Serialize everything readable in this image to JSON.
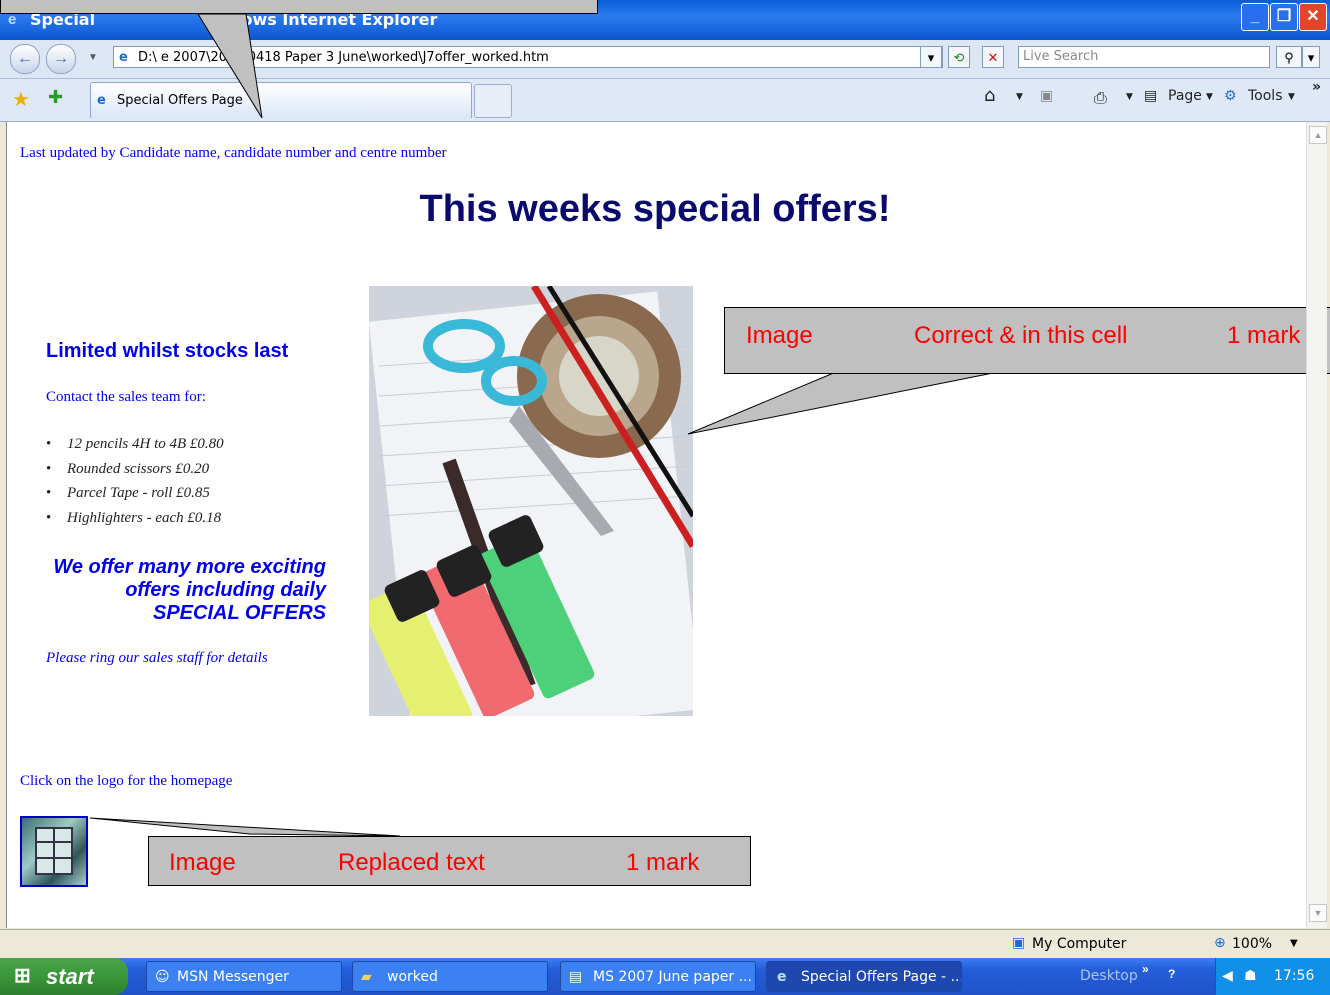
{
  "window": {
    "title": "Special Offers Page - Windows Internet Explorer",
    "title_visible_left": "Special",
    "title_visible_right": "lows Internet Explorer"
  },
  "address": {
    "visible_text": "D:\\                    e 2007\\2007 0418 Paper 3 June\\worked\\J7offer_worked.htm",
    "search_placeholder": "Live Search"
  },
  "tabs": [
    {
      "label": "Special Offers Page"
    }
  ],
  "commandbar": {
    "page_label": "Page",
    "tools_label": "Tools",
    "more": "»"
  },
  "page": {
    "last_updated": "Last updated by Candidate name, candidate number and centre number",
    "heading": "This weeks special offers!",
    "limited": "Limited whilst stocks last",
    "contact": "Contact the sales team for:",
    "offers": [
      "12 pencils 4H to 4B £0.80",
      "Rounded scissors £0.20",
      "Parcel Tape - roll £0.85",
      "Highlighters - each £0.18"
    ],
    "we_offer_line1": "We offer many more exciting",
    "we_offer_line2": "offers including daily",
    "we_offer_line3": "SPECIAL OFFERS",
    "ring": "Please ring our sales staff for details",
    "click_logo": "Click on the logo for the homepage"
  },
  "callouts": {
    "image_cell": {
      "c1": "Image",
      "c2": "Correct & in this cell",
      "c3": "1 mark"
    },
    "logo": {
      "c1": "Image",
      "c2": "Replaced text",
      "c3": "1 mark"
    }
  },
  "status": {
    "zone": "My Computer",
    "zoom": "100%"
  },
  "taskbar": {
    "start": "start",
    "items": [
      {
        "label": "MSN Messenger"
      },
      {
        "label": "worked"
      },
      {
        "label": "MS 2007 June paper ..."
      },
      {
        "label": "Special Offers Page - ..."
      }
    ],
    "desktop": "Desktop",
    "clock": "17:56"
  },
  "colors": {
    "link": "#0000ee",
    "heading": "#0a0a6e",
    "callout_text": "#ff0000",
    "callout_bg": "#c0c0c0"
  }
}
